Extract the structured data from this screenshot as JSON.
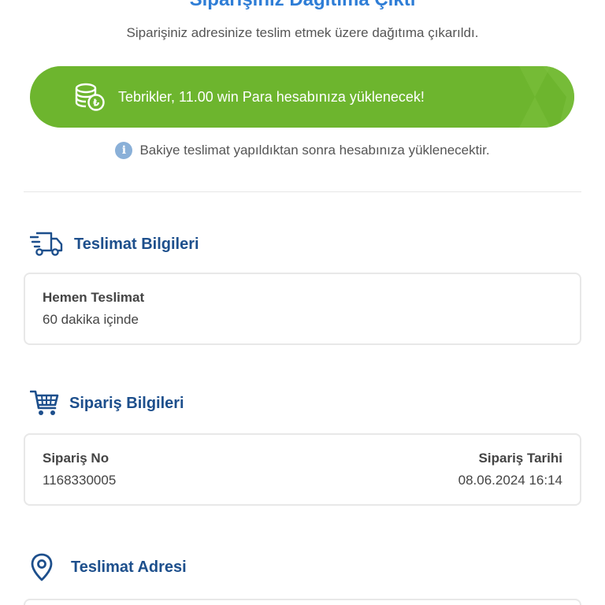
{
  "header": {
    "title": "Siparişiniz Dağıtıma Çıktı",
    "subtitle": "Siparişiniz adresinize teslim etmek üzere dağıtıma çıkarıldı."
  },
  "reward": {
    "message": "Tebrikler, 11.00 win Para hesabınıza yüklenecek!",
    "color": "#6db52e"
  },
  "note": {
    "text": "Bakiye teslimat yapıldıktan sonra hesabınıza yüklenecektir."
  },
  "delivery_info": {
    "title": "Teslimat Bilgileri",
    "type_label": "Hemen Teslimat",
    "type_value": "60 dakika içinde"
  },
  "order_info": {
    "title": "Sipariş Bilgileri",
    "order_no_label": "Sipariş No",
    "order_no_value": "1168330005",
    "order_date_label": "Sipariş Tarihi",
    "order_date_value": "08.06.2024 16:14"
  },
  "address": {
    "title": "Teslimat Adresi"
  },
  "colors": {
    "accent": "#2e7dd6",
    "section_title": "#1d4f8c"
  }
}
